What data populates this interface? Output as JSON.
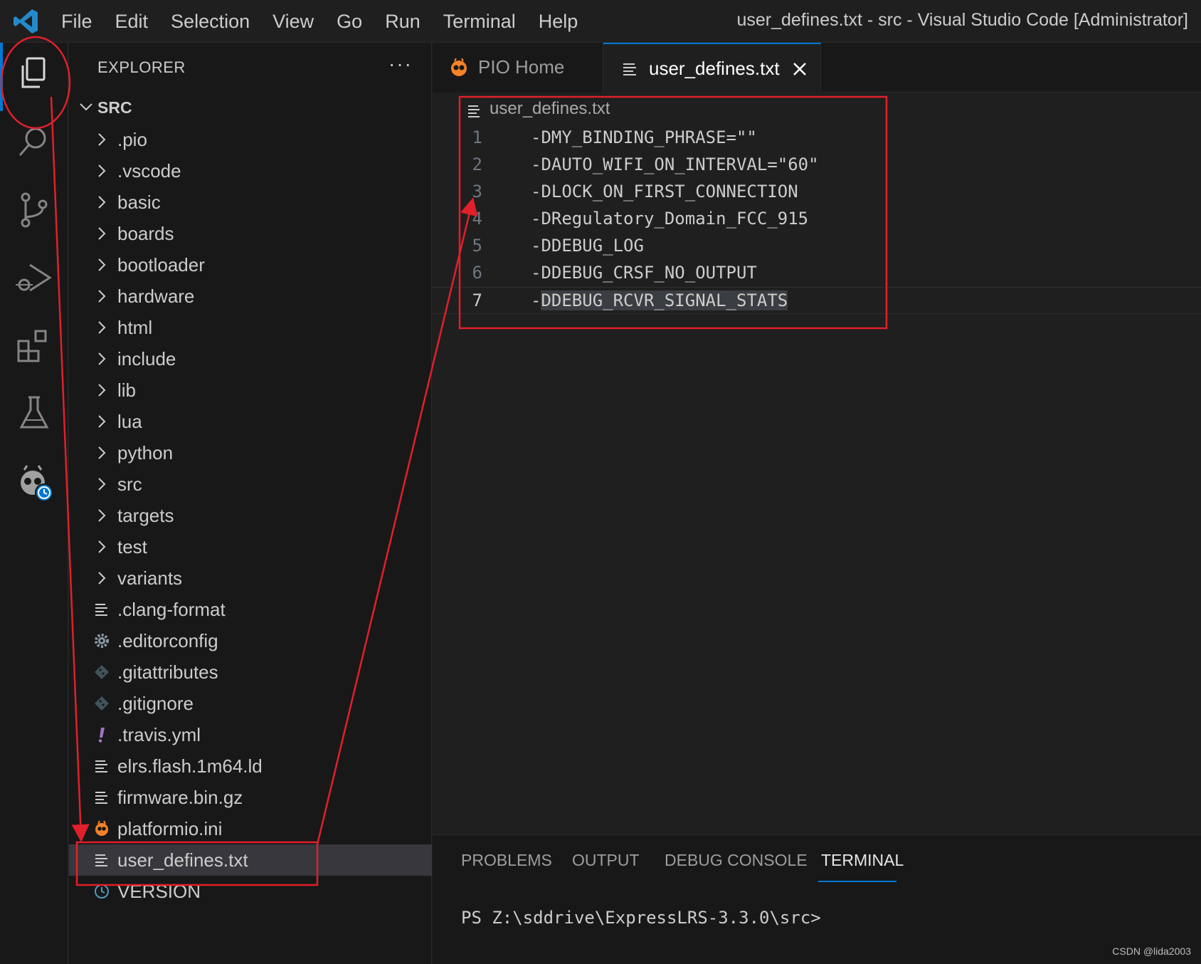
{
  "menu": [
    "File",
    "Edit",
    "Selection",
    "View",
    "Go",
    "Run",
    "Terminal",
    "Help"
  ],
  "window_title": "user_defines.txt - src - Visual Studio Code [Administrator]",
  "sidebar": {
    "title": "EXPLORER",
    "more": "···",
    "section": "SRC",
    "items": [
      {
        "label": ".pio",
        "icon": "chevron-right-icon"
      },
      {
        "label": ".vscode",
        "icon": "chevron-right-icon"
      },
      {
        "label": "basic",
        "icon": "chevron-right-icon"
      },
      {
        "label": "boards",
        "icon": "chevron-right-icon"
      },
      {
        "label": "bootloader",
        "icon": "chevron-right-icon"
      },
      {
        "label": "hardware",
        "icon": "chevron-right-icon"
      },
      {
        "label": "html",
        "icon": "chevron-right-icon"
      },
      {
        "label": "include",
        "icon": "chevron-right-icon"
      },
      {
        "label": "lib",
        "icon": "chevron-right-icon"
      },
      {
        "label": "lua",
        "icon": "chevron-right-icon"
      },
      {
        "label": "python",
        "icon": "chevron-right-icon"
      },
      {
        "label": "src",
        "icon": "chevron-right-icon"
      },
      {
        "label": "targets",
        "icon": "chevron-right-icon"
      },
      {
        "label": "test",
        "icon": "chevron-right-icon"
      },
      {
        "label": "variants",
        "icon": "chevron-right-icon"
      },
      {
        "label": ".clang-format",
        "icon": "text-file-icon"
      },
      {
        "label": ".editorconfig",
        "icon": "gear-icon"
      },
      {
        "label": ".gitattributes",
        "icon": "git-icon"
      },
      {
        "label": ".gitignore",
        "icon": "git-icon"
      },
      {
        "label": ".travis.yml",
        "icon": "exclamation-icon"
      },
      {
        "label": "elrs.flash.1m64.ld",
        "icon": "text-file-icon"
      },
      {
        "label": "firmware.bin.gz",
        "icon": "text-file-icon"
      },
      {
        "label": "platformio.ini",
        "icon": "platformio-icon"
      },
      {
        "label": "user_defines.txt",
        "icon": "text-file-icon"
      },
      {
        "label": "VERSION",
        "icon": "clock-icon"
      }
    ]
  },
  "tabs": [
    {
      "label": "PIO Home"
    },
    {
      "label": "user_defines.txt"
    }
  ],
  "breadcrumb": "user_defines.txt",
  "code_lines": [
    {
      "n": "1",
      "text": "-DMY_BINDING_PHRASE=\"\""
    },
    {
      "n": "2",
      "text": "-DAUTO_WIFI_ON_INTERVAL=\"60\""
    },
    {
      "n": "3",
      "text": "-DLOCK_ON_FIRST_CONNECTION"
    },
    {
      "n": "4",
      "text": "-DRegulatory_Domain_FCC_915"
    },
    {
      "n": "5",
      "text": "-DDEBUG_LOG"
    },
    {
      "n": "6",
      "text": "-DDEBUG_CRSF_NO_OUTPUT"
    },
    {
      "n": "7",
      "text_prefix": "-",
      "text_selected": "DDEBUG_RCVR_SIGNAL_STATS"
    }
  ],
  "panel": {
    "tabs": [
      "PROBLEMS",
      "OUTPUT",
      "DEBUG CONSOLE",
      "TERMINAL"
    ],
    "active_tab": "TERMINAL",
    "terminal_prompt": "PS Z:\\sddrive\\ExpressLRS-3.3.0\\src>"
  },
  "watermark": "CSDN @lida2003",
  "colors": {
    "accent": "#0078d4",
    "annotation": "#e0202a",
    "platformio": "#f5822a"
  }
}
